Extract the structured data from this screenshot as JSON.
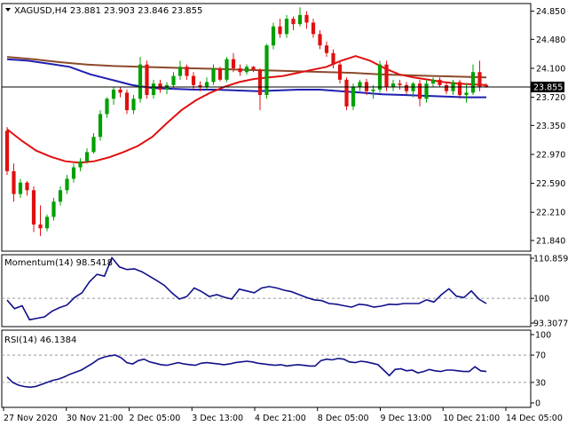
{
  "chart_data": [
    {
      "type": "candlestick",
      "title": "XAGUSD,H4  23.881 23.903 23.846 23.855",
      "current_price": "23.855",
      "ylim": [
        21.7,
        24.95
      ],
      "y_ticks": [
        "24.850",
        "24.480",
        "24.100",
        "23.720",
        "23.350",
        "22.970",
        "22.590",
        "22.210",
        "21.840"
      ],
      "x_ticks": [
        "27 Nov 2020",
        "30 Nov 21:00",
        "2 Dec 05:00",
        "3 Dec 13:00",
        "4 Dec 21:00",
        "8 Dec 05:00",
        "9 Dec 13:00",
        "10 Dec 21:00",
        "14 Dec 05:00"
      ],
      "colors": {
        "up": "#00a000",
        "down": "#e01010",
        "ma_fast": "#e01010",
        "ma_mid": "#8b4a2b",
        "ma_slow": "#1f1fb0"
      },
      "ohlc": [
        [
          23.28,
          23.33,
          22.7,
          22.75
        ],
        [
          22.75,
          22.85,
          22.35,
          22.45
        ],
        [
          22.45,
          22.65,
          22.4,
          22.6
        ],
        [
          22.6,
          22.62,
          22.43,
          22.5
        ],
        [
          22.5,
          22.55,
          21.95,
          22.05
        ],
        [
          22.05,
          22.3,
          21.9,
          22.0
        ],
        [
          22.0,
          22.18,
          21.96,
          22.15
        ],
        [
          22.15,
          22.4,
          22.1,
          22.35
        ],
        [
          22.35,
          22.55,
          22.3,
          22.5
        ],
        [
          22.5,
          22.7,
          22.45,
          22.65
        ],
        [
          22.65,
          22.85,
          22.6,
          22.8
        ],
        [
          22.8,
          22.92,
          22.75,
          22.88
        ],
        [
          22.88,
          23.05,
          22.85,
          23.0
        ],
        [
          23.0,
          23.25,
          22.98,
          23.2
        ],
        [
          23.2,
          23.55,
          23.15,
          23.5
        ],
        [
          23.5,
          23.72,
          23.45,
          23.7
        ],
        [
          23.7,
          23.85,
          23.62,
          23.82
        ],
        [
          23.82,
          23.86,
          23.72,
          23.78
        ],
        [
          23.78,
          23.82,
          23.5,
          23.55
        ],
        [
          23.55,
          23.75,
          23.5,
          23.7
        ],
        [
          23.7,
          24.25,
          23.65,
          24.15
        ],
        [
          24.15,
          24.2,
          23.7,
          23.75
        ],
        [
          23.75,
          23.95,
          23.7,
          23.9
        ],
        [
          23.9,
          23.95,
          23.78,
          23.82
        ],
        [
          23.82,
          23.92,
          23.76,
          23.88
        ],
        [
          23.88,
          24.05,
          23.82,
          24.0
        ],
        [
          24.0,
          24.2,
          23.95,
          24.12
        ],
        [
          24.12,
          24.15,
          23.95,
          24.0
        ],
        [
          24.0,
          24.05,
          23.82,
          23.88
        ],
        [
          23.88,
          23.93,
          23.8,
          23.85
        ],
        [
          23.85,
          23.98,
          23.82,
          23.92
        ],
        [
          23.92,
          24.15,
          23.88,
          24.1
        ],
        [
          24.1,
          24.12,
          23.93,
          23.95
        ],
        [
          23.95,
          24.25,
          23.92,
          24.22
        ],
        [
          24.22,
          24.3,
          24.05,
          24.1
        ],
        [
          24.1,
          24.15,
          24.0,
          24.05
        ],
        [
          24.05,
          24.15,
          24.02,
          24.12
        ],
        [
          24.12,
          24.13,
          24.05,
          24.08
        ],
        [
          24.08,
          24.1,
          23.55,
          23.75
        ],
        [
          23.75,
          24.42,
          23.7,
          24.4
        ],
        [
          24.4,
          24.7,
          24.35,
          24.65
        ],
        [
          24.65,
          24.75,
          24.5,
          24.55
        ],
        [
          24.55,
          24.8,
          24.5,
          24.75
        ],
        [
          24.75,
          24.78,
          24.6,
          24.68
        ],
        [
          24.68,
          24.9,
          24.65,
          24.8
        ],
        [
          24.8,
          24.85,
          24.62,
          24.7
        ],
        [
          24.7,
          24.75,
          24.5,
          24.55
        ],
        [
          24.55,
          24.6,
          24.35,
          24.4
        ],
        [
          24.4,
          24.45,
          24.25,
          24.3
        ],
        [
          24.3,
          24.35,
          24.1,
          24.15
        ],
        [
          24.15,
          24.2,
          23.9,
          23.95
        ],
        [
          23.95,
          23.98,
          23.55,
          23.6
        ],
        [
          23.6,
          23.9,
          23.55,
          23.85
        ],
        [
          23.85,
          23.95,
          23.8,
          23.92
        ],
        [
          23.92,
          23.96,
          23.75,
          23.8
        ],
        [
          23.8,
          23.88,
          23.7,
          23.82
        ],
        [
          23.82,
          24.2,
          23.78,
          24.15
        ],
        [
          24.15,
          24.2,
          23.8,
          23.85
        ],
        [
          23.85,
          23.95,
          23.8,
          23.9
        ],
        [
          23.9,
          23.95,
          23.82,
          23.88
        ],
        [
          23.88,
          23.92,
          23.76,
          23.8
        ],
        [
          23.8,
          23.92,
          23.72,
          23.9
        ],
        [
          23.9,
          23.95,
          23.6,
          23.7
        ],
        [
          23.7,
          23.95,
          23.65,
          23.9
        ],
        [
          23.9,
          23.98,
          23.85,
          23.95
        ],
        [
          23.95,
          23.98,
          23.85,
          23.88
        ],
        [
          23.88,
          23.92,
          23.76,
          23.8
        ],
        [
          23.8,
          23.95,
          23.75,
          23.92
        ],
        [
          23.92,
          23.95,
          23.7,
          23.75
        ],
        [
          23.75,
          23.9,
          23.65,
          23.78
        ],
        [
          23.78,
          24.15,
          23.75,
          24.05
        ],
        [
          24.05,
          24.2,
          23.8,
          23.85
        ],
        [
          23.881,
          23.903,
          23.846,
          23.855
        ]
      ],
      "ma_fast": [
        23.3,
        23.15,
        23.02,
        22.94,
        22.88,
        22.86,
        22.88,
        22.93,
        23.0,
        23.08,
        23.2,
        23.38,
        23.55,
        23.68,
        23.78,
        23.86,
        23.92,
        23.96,
        23.98,
        24.0,
        24.04,
        24.08,
        24.12,
        24.2,
        24.26,
        24.2,
        24.1,
        24.02,
        23.98,
        23.95,
        23.92,
        23.9,
        23.89,
        23.88
      ],
      "ma_mid": [
        24.25,
        24.22,
        24.18,
        24.15,
        24.13,
        24.12,
        24.11,
        24.1,
        24.09,
        24.08,
        24.07,
        24.06,
        24.05,
        24.04,
        24.02,
        24.01,
        24.0,
        23.99,
        23.98
      ],
      "ma_slow": [
        24.22,
        24.2,
        24.16,
        24.12,
        24.02,
        23.95,
        23.88,
        23.84,
        23.83,
        23.82,
        23.82,
        23.81,
        23.8,
        23.81,
        23.82,
        23.82,
        23.8,
        23.78,
        23.76,
        23.75,
        23.74,
        23.73,
        23.72,
        23.72
      ]
    },
    {
      "type": "line",
      "title": "Momentum(14) 98.5418",
      "current_value": "98.5418",
      "ylim": [
        93.3077,
        110.8597
      ],
      "y_ticks": [
        "110.8597",
        "100",
        "93.3077"
      ],
      "reference_level": 100,
      "values": [
        99.5,
        97.2,
        98.0,
        94.2,
        94.6,
        95.0,
        96.5,
        97.5,
        98.2,
        100.2,
        101.5,
        104.5,
        106.5,
        106.0,
        111.0,
        108.5,
        107.8,
        108.0,
        107.2,
        106.0,
        104.8,
        103.5,
        101.5,
        99.8,
        100.5,
        102.8,
        101.8,
        100.5,
        101.0,
        100.3,
        99.8,
        102.5,
        102.0,
        101.5,
        102.8,
        103.2,
        102.8,
        102.2,
        101.8,
        101.0,
        100.2,
        99.6,
        99.4,
        98.6,
        98.4,
        98.0,
        97.6,
        98.4,
        98.2,
        97.6,
        97.9,
        98.4,
        98.3,
        98.6,
        98.6,
        98.6,
        99.6,
        99.0,
        101.0,
        102.6,
        100.6,
        100.2,
        102.0,
        99.8,
        98.6
      ]
    },
    {
      "type": "line",
      "title": "RSI(14) 46.1384",
      "current_value": "46.1384",
      "ylim": [
        0,
        100
      ],
      "y_ticks": [
        "100",
        "70",
        "30",
        "0"
      ],
      "levels": [
        70,
        30
      ],
      "values": [
        38,
        30,
        26,
        24,
        23,
        24,
        27,
        30,
        33,
        35,
        38,
        42,
        45,
        48,
        53,
        58,
        64,
        67,
        69,
        70,
        66,
        59,
        57,
        62,
        64,
        60,
        58,
        56,
        55,
        57,
        59,
        57,
        56,
        55,
        58,
        59,
        58,
        57,
        56,
        57,
        59,
        60,
        61,
        60,
        58,
        57,
        56,
        55,
        56,
        54,
        55,
        56,
        55,
        54,
        54,
        62,
        64,
        63,
        65,
        64,
        60,
        59,
        61,
        60,
        58,
        56,
        48,
        40,
        49,
        50,
        47,
        48,
        44,
        46,
        49,
        47,
        46,
        48,
        48,
        47,
        46,
        46,
        53,
        47,
        46
      ]
    }
  ]
}
